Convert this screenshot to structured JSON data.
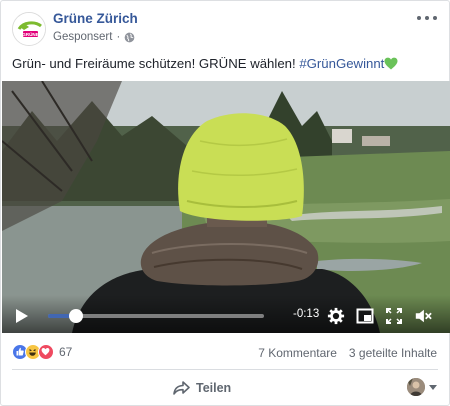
{
  "post": {
    "page_name": "Grüne Zürich",
    "sponsored": "Gesponsert",
    "dot": "·",
    "text_main": "Grün- und Freiräume schützen! GRÜNE wählen! ",
    "hashtag": "#GrünGewinnt",
    "avatar_text": "GRÜNE"
  },
  "video": {
    "time_remaining": "-0:13",
    "progress": 0.13,
    "icons": [
      "play-icon",
      "gear-icon",
      "theater-mode-icon",
      "fullscreen-icon",
      "mute-icon"
    ]
  },
  "footer": {
    "reaction_count": "67",
    "reactions": [
      "like",
      "haha",
      "love"
    ],
    "comments": "7 Kommentare",
    "shares": "3 geteilte Inhalte",
    "share_label": "Teilen"
  },
  "colors": {
    "link": "#365899",
    "accent": "#4267b2",
    "heart": "#6ac259"
  }
}
